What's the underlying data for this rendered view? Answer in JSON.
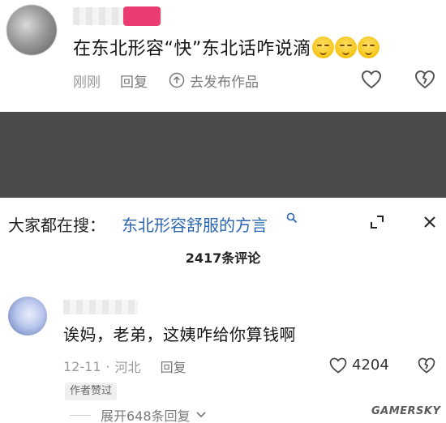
{
  "top_comment": {
    "text": "在东北形容“快”东北话咋说滴",
    "emoji_icon": "sad-face-emoji",
    "time": "刚刚",
    "reply_label": "回复",
    "publish_label": "去发布作品"
  },
  "search": {
    "prefix": "大家都在搜：",
    "query": "东北形容舒服的方言"
  },
  "comment_count": "2417条评论",
  "comment": {
    "text": "诶妈，老弟，这姨咋给你算钱啊",
    "date": "12-11",
    "location": "河北",
    "reply_label": "回复",
    "likes": "4204",
    "author_badge": "作者赞过",
    "expand_replies": "展开648条回复"
  },
  "watermark": "GAMERSKY",
  "colors": {
    "link": "#2a65b0",
    "badge": "#e8336b",
    "gray_block": "#4a4a4a"
  }
}
